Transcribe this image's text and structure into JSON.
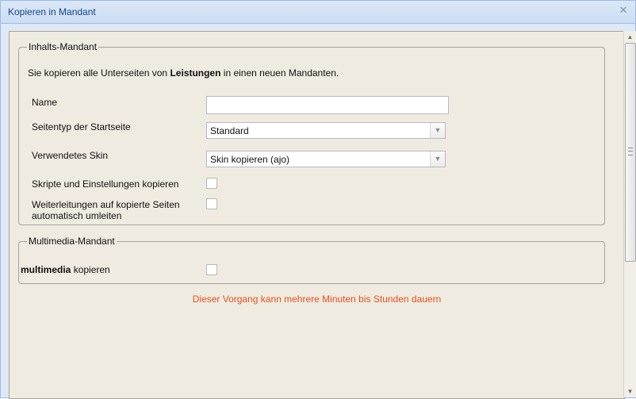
{
  "window": {
    "title": "Kopieren in Mandant",
    "close_icon": "close-icon"
  },
  "inhalts": {
    "legend": "Inhalts-Mandant",
    "intro_prefix": "Sie kopieren alle Unterseiten von ",
    "intro_bold": "Leistungen",
    "intro_suffix": " in einen neuen Mandanten.",
    "name_label": "Name",
    "name_value": "",
    "seitentyp_label": "Seitentyp der Startseite",
    "seitentyp_value": "Standard",
    "skin_label": "Verwendetes Skin",
    "skin_value": "Skin kopieren (ajo)",
    "skripte_label": "Skripte und Einstellungen kopieren",
    "weiterleitungen_label_1": "Weiterleitungen auf kopierte Seiten",
    "weiterleitungen_label_2": "automatisch umleiten"
  },
  "multimedia": {
    "legend": "Multimedia-Mandant",
    "label_bold": "multimedia",
    "label_suffix": " kopieren"
  },
  "notice": "Dieser Vorgang kann mehrere Minuten bis Stunden dauern",
  "colors": {
    "notice": "#e8501f",
    "title": "#15428b",
    "panel_bg": "#efebe0"
  }
}
